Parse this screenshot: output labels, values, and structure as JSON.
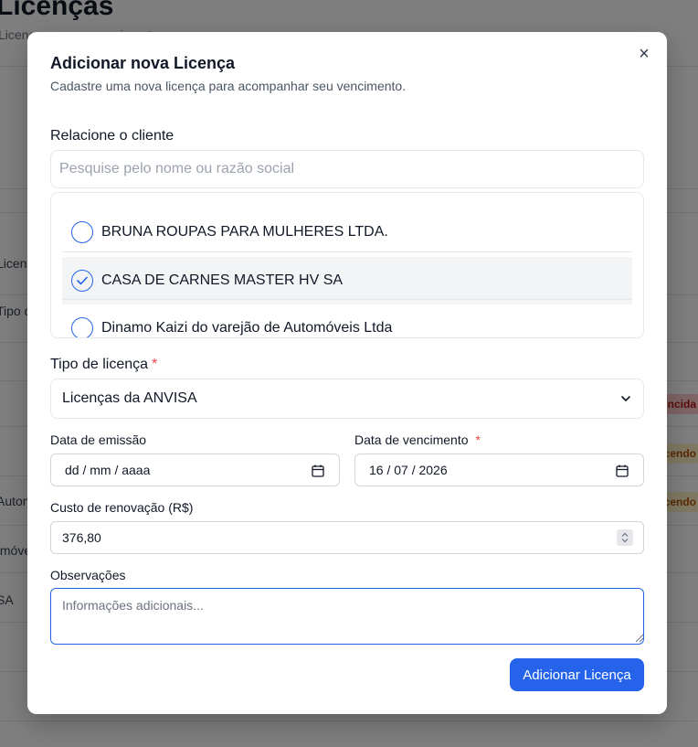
{
  "background": {
    "title": "Licenças",
    "subtitle": "Licenças e seus vencimentos",
    "rows": [
      "Licenças",
      "Tipo de licença",
      "Automóveis",
      "Imóveis",
      "SA"
    ],
    "badges": [
      "Vencida",
      "Vencendo",
      "Vencendo"
    ]
  },
  "modal": {
    "title": "Adicionar nova Licença",
    "description": "Cadastre uma nova licença para acompanhar seu vencimento.",
    "close_icon": "×"
  },
  "client": {
    "label": "Relacione o cliente",
    "search_placeholder": "Pesquise pelo nome ou razão social",
    "search_value": "",
    "items": [
      {
        "name": "BRUNA ROUPAS PARA MULHERES LTDA.",
        "selected": false
      },
      {
        "name": "CASA DE CARNES MASTER HV SA",
        "selected": true
      },
      {
        "name": "Dinamo Kaizi do varejão de Automóveis Ltda",
        "selected": false
      }
    ]
  },
  "license_type": {
    "label": "Tipo de licença",
    "required_mark": "*",
    "selected": "Licenças da ANVISA"
  },
  "issue_date": {
    "label": "Data de emissão",
    "value": "dd / mm / aaaa"
  },
  "due_date": {
    "label": "Data de vencimento",
    "required_mark": "*",
    "value": "16 / 07 / 2026"
  },
  "renewal_cost": {
    "label": "Custo de renovação (R$)",
    "value": "376,80"
  },
  "notes": {
    "label": "Observações",
    "placeholder": "Informações adicionais...",
    "value": ""
  },
  "submit_label": "Adicionar Licença",
  "colors": {
    "accent": "#2563eb",
    "required": "#ef4444",
    "overlay": "rgba(0,0,0,0.5)"
  },
  "icons": {
    "close": "close-icon",
    "check": "check-icon",
    "chevron": "chevron-down-icon",
    "calendar": "calendar-icon",
    "spinner": "spinner-icon"
  }
}
